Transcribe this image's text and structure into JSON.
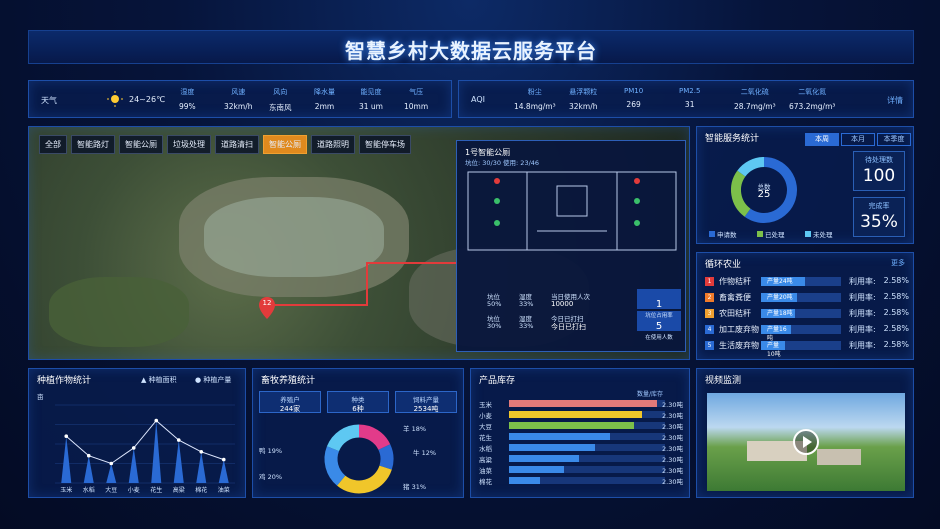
{
  "header": {
    "title": "智慧乡村大数据云服务平台"
  },
  "weather": {
    "label": "天气",
    "temp": "24~26℃",
    "items": [
      {
        "k": "湿度",
        "v": "99%"
      },
      {
        "k": "风速",
        "v": "32km/h"
      },
      {
        "k": "风向",
        "v": "东南风"
      },
      {
        "k": "降水量",
        "v": "2mm"
      },
      {
        "k": "能见度",
        "v": "31 um"
      },
      {
        "k": "气压",
        "v": "10mm"
      }
    ]
  },
  "air": {
    "label": "AQI",
    "items": [
      {
        "k": "粉尘",
        "v": "14.8mg/m³"
      },
      {
        "k": "悬浮颗粒",
        "v": "32km/h"
      },
      {
        "k": "PM10",
        "v": "269"
      },
      {
        "k": "PM2.5",
        "v": "31"
      },
      {
        "k": "二氧化硫",
        "v": "28.7mg/m³"
      },
      {
        "k": "二氧化氮",
        "v": "673.2mg/m³"
      }
    ],
    "more": "详情"
  },
  "map": {
    "tabs": [
      "全部",
      "智能路灯",
      "智能公厕",
      "垃圾处理",
      "道路清扫",
      "智能公厕",
      "道路照明",
      "智能停车场"
    ],
    "active": 5,
    "marker": "12",
    "popup": {
      "title": "1号智能公厕",
      "sub": "坑位: 30/30 使用: 23/46",
      "stats": [
        {
          "a": "坑位",
          "b": "50%",
          "c": "湿度",
          "d": "33%"
        },
        {
          "a": "坑位",
          "b": "30%",
          "c": "湿度",
          "d": "33%"
        }
      ],
      "labels": [
        "当日使用人次",
        "今日已打扫"
      ],
      "values": [
        "10000",
        "今日已打扫"
      ],
      "badges": [
        {
          "n": "1",
          "t": "坑位占用率"
        },
        {
          "n": "5",
          "t": "在使用人数"
        }
      ]
    }
  },
  "service": {
    "title": "智能服务统计",
    "tabs": [
      "本周",
      "本月",
      "本季度"
    ],
    "active": 0,
    "donut": {
      "label": "总数",
      "value": "25",
      "slices": [
        {
          "name": "申请数",
          "v": 60,
          "color": "#2a6ad4"
        },
        {
          "name": "已处理",
          "v": 25,
          "color": "#7cc04a"
        },
        {
          "name": "未处理",
          "v": 15,
          "color": "#5ec8f2"
        }
      ]
    },
    "kpis": [
      {
        "l": "待处理数",
        "n": "100"
      },
      {
        "l": "完成率",
        "n": "35%"
      }
    ]
  },
  "cycle": {
    "title": "循环农业",
    "more": "更多",
    "rows": [
      {
        "no": "1",
        "nm": "作物秸秆",
        "fill": "产量24吨",
        "w": 0.55,
        "ul": "利用率:",
        "pct": "2.58%",
        "c": "#e23b3b"
      },
      {
        "no": "2",
        "nm": "畜禽粪便",
        "fill": "产量20吨",
        "w": 0.45,
        "ul": "利用率:",
        "pct": "2.58%",
        "c": "#f07a2a"
      },
      {
        "no": "3",
        "nm": "农田秸秆",
        "fill": "产量18吨",
        "w": 0.42,
        "ul": "利用率:",
        "pct": "2.58%",
        "c": "#f0a030"
      },
      {
        "no": "4",
        "nm": "加工废弃物",
        "fill": "产量16吨",
        "w": 0.38,
        "ul": "利用率:",
        "pct": "2.58%",
        "c": "#2a6ad4"
      },
      {
        "no": "5",
        "nm": "生活废弃物",
        "fill": "产量10吨",
        "w": 0.3,
        "ul": "利用率:",
        "pct": "2.58%",
        "c": "#2a6ad4"
      }
    ]
  },
  "plant": {
    "title": "种植作物统计",
    "legend": [
      "种植面积",
      "种植产量"
    ],
    "yl": "亩",
    "cats": [
      "玉米",
      "水稻",
      "大豆",
      "小麦",
      "花生",
      "高粱",
      "棉花",
      "油菜"
    ],
    "vals": [
      60,
      35,
      25,
      45,
      80,
      55,
      40,
      30
    ],
    "ymax": 100
  },
  "livestock": {
    "title": "畜牧养殖统计",
    "kpi": [
      {
        "a": "养殖户",
        "b": "244家"
      },
      {
        "a": "种类",
        "b": "6种"
      },
      {
        "a": "饲料产量",
        "b": "2534吨"
      }
    ],
    "slices": [
      {
        "name": "羊 18%",
        "v": 18,
        "c": "#e23b8a"
      },
      {
        "name": "牛 12%",
        "v": 12,
        "c": "#2a6ad4"
      },
      {
        "name": "猪 31%",
        "v": 31,
        "c": "#f0c62a"
      },
      {
        "name": "鸡 20%",
        "v": 20,
        "c": "#3a8ae8"
      },
      {
        "name": "鸭 19%",
        "v": 19,
        "c": "#5ec8f2"
      }
    ]
  },
  "stock": {
    "title": "产品库存",
    "head": "数量/库存",
    "rows": [
      {
        "nm": "玉米",
        "w": 0.95,
        "c": "#e27a7a",
        "v": "2.30吨"
      },
      {
        "nm": "小麦",
        "w": 0.85,
        "c": "#f0c62a",
        "v": "2.30吨"
      },
      {
        "nm": "大豆",
        "w": 0.8,
        "c": "#7cc04a",
        "v": "2.30吨"
      },
      {
        "nm": "花生",
        "w": 0.65,
        "c": "#3a8ae8",
        "v": "2.30吨"
      },
      {
        "nm": "水稻",
        "w": 0.55,
        "c": "#3a8ae8",
        "v": "2.30吨"
      },
      {
        "nm": "高粱",
        "w": 0.45,
        "c": "#3a8ae8",
        "v": "2.30吨"
      },
      {
        "nm": "油菜",
        "w": 0.35,
        "c": "#3a8ae8",
        "v": "2.30吨"
      },
      {
        "nm": "棉花",
        "w": 0.2,
        "c": "#3a8ae8",
        "v": "2.30吨"
      }
    ]
  },
  "video": {
    "title": "视频监测"
  }
}
